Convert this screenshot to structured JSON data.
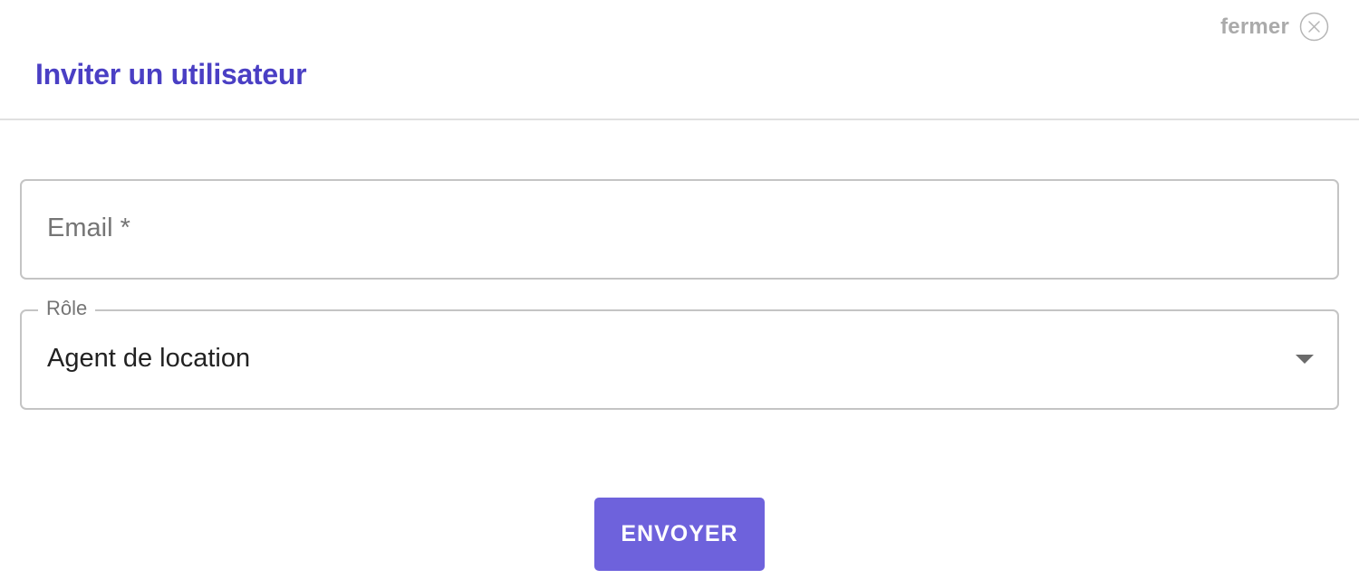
{
  "modal": {
    "close_label": "fermer",
    "title": "Inviter un utilisateur"
  },
  "form": {
    "email": {
      "placeholder": "Email *"
    },
    "role": {
      "label": "Rôle",
      "selected_value": "Agent de location"
    },
    "submit_label": "ENVOYER"
  },
  "icons": {
    "close": "close-circle-icon",
    "dropdown": "caret-down-icon"
  },
  "colors": {
    "title": "#4a3fc4",
    "button_bg": "#6e62dc",
    "close_label": "#aaaaaa",
    "field_border": "#c4c4c4"
  }
}
